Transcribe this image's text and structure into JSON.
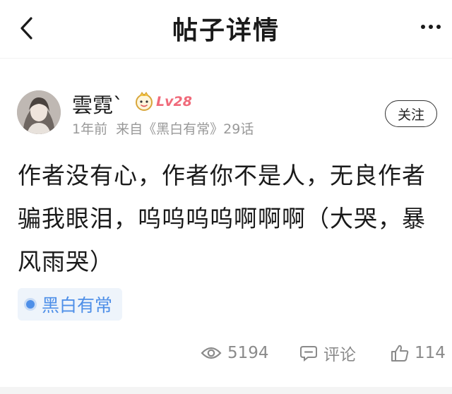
{
  "header": {
    "title": "帖子详情",
    "back_icon": "back-arrow-icon",
    "more_icon": "more-dots-icon"
  },
  "author": {
    "name": "雲霓`",
    "level": "Lv28",
    "level_icon": "level-emoji-icon",
    "time": "1年前",
    "source_prefix": "来自",
    "comic": "《黑白有常》",
    "chapter": "29话",
    "follow_label": "关注"
  },
  "post": {
    "text": "作者没有心，作者你不是人，无良作者骗我眼泪，呜呜呜呜啊啊啊（大哭，暴风雨哭）"
  },
  "tag": {
    "label": "黑白有常",
    "color": "#4e8fe8"
  },
  "stats": {
    "views": "5194",
    "comment_label": "评论",
    "likes": "114"
  },
  "colors": {
    "text": "#1a1a1a",
    "meta": "#999999",
    "level": "#f06a7a",
    "tag_bg": "#eef4fb"
  }
}
